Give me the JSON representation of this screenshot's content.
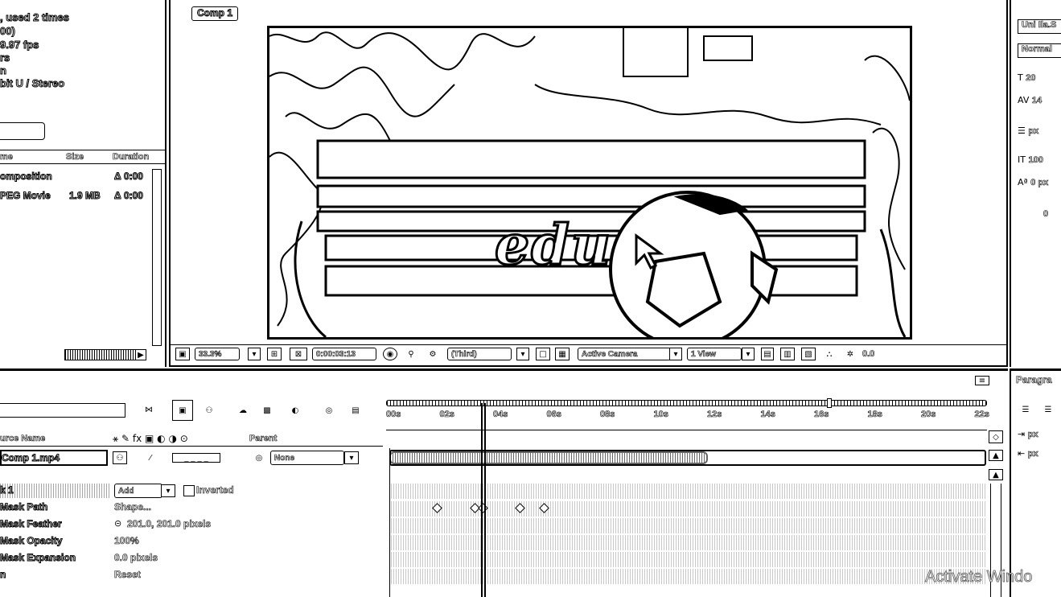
{
  "project": {
    "info_lines": [
      ", used 2 times",
      "00)",
      "9.97 fps",
      "rs",
      "n",
      "bit U / Stereo"
    ],
    "columns": [
      "me",
      "Size",
      "Duration"
    ],
    "items": [
      {
        "name": "omposition",
        "size": "",
        "duration": "Δ 0:00"
      },
      {
        "name": "PEG Movie",
        "size": "1.9 MB",
        "duration": "Δ 0:00"
      }
    ]
  },
  "viewer": {
    "comp_tab": "Comp 1",
    "overlay_text": "edu",
    "toolbar": {
      "zoom": "33.3%",
      "timecode": "0:00:03:13",
      "resolution": "(Third)",
      "camera": "Active Camera",
      "view": "1 View",
      "exposure": "0.0"
    }
  },
  "character": {
    "font": "Uni Ila.S",
    "style": "Normal",
    "size": "20",
    "tracking": "14",
    "leading": "px",
    "scale": "100",
    "baseline": "0 px",
    "tsume": "0"
  },
  "timeline": {
    "header": {
      "source_name": "urce Name",
      "parent": "Parent"
    },
    "ruler_ticks": [
      "00s",
      "02s",
      "04s",
      "06s",
      "08s",
      "10s",
      "12s",
      "14s",
      "16s",
      "18s",
      "20s",
      "22s"
    ],
    "layer": {
      "name": "Comp 1.mp4",
      "parent": "None"
    },
    "mask": {
      "name": "k 1",
      "mode": "Add",
      "inverted": "Inverted"
    },
    "properties": [
      {
        "name": "Mask Path",
        "value": "Shape..."
      },
      {
        "name": "Mask Feather",
        "value": "201.0, 201.0 pixels"
      },
      {
        "name": "Mask Opacity",
        "value": "100%"
      },
      {
        "name": "Mask Expansion",
        "value": "0.0 pixels"
      },
      {
        "name": "n",
        "value": "Reset"
      }
    ],
    "keyframes": [
      1.6,
      3.0,
      3.3,
      4.7,
      5.6
    ]
  },
  "paragraph": {
    "title": "Paragra",
    "indent1": "px",
    "indent2": "px"
  },
  "watermark": "Activate Windo"
}
